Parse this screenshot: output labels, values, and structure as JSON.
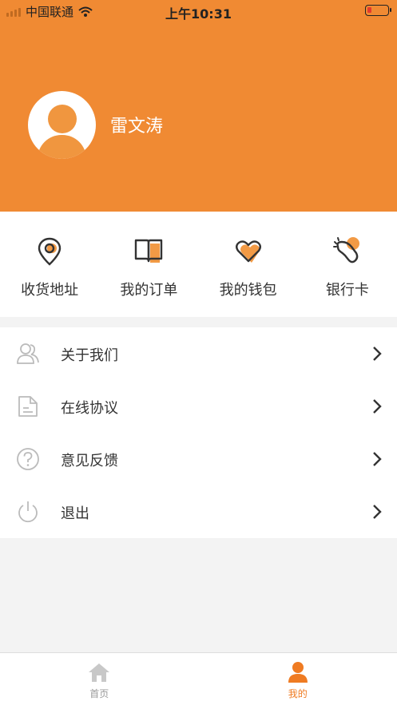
{
  "status_bar": {
    "carrier": "中国联通",
    "time": "上午10:31",
    "signal_icon": "signal-bars-icon",
    "wifi_icon": "wifi-icon",
    "battery_icon": "battery-low-icon",
    "battery_level": 0.15
  },
  "profile": {
    "username": "雷文涛",
    "avatar_icon": "user-avatar-icon",
    "header_color": "#f08a33"
  },
  "shortcuts": [
    {
      "label": "收货地址",
      "icon": "location-pin-icon"
    },
    {
      "label": "我的订单",
      "icon": "book-icon"
    },
    {
      "label": "我的钱包",
      "icon": "heart-icon"
    },
    {
      "label": "银行卡",
      "icon": "card-icon"
    }
  ],
  "menu": [
    {
      "label": "关于我们",
      "icon": "people-icon"
    },
    {
      "label": "在线协议",
      "icon": "document-icon"
    },
    {
      "label": "意见反馈",
      "icon": "question-icon"
    },
    {
      "label": "退出",
      "icon": "power-icon"
    }
  ],
  "tabbar": {
    "tabs": [
      {
        "label": "首页",
        "icon": "home-icon",
        "active": false
      },
      {
        "label": "我的",
        "icon": "person-icon",
        "active": true
      }
    ],
    "active_color": "#ef7b22",
    "inactive_color": "#999999"
  }
}
